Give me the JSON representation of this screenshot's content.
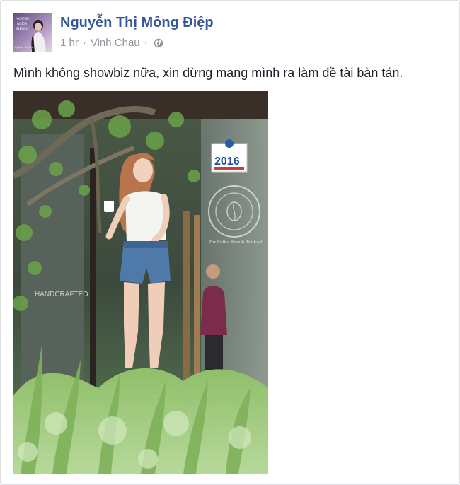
{
  "post": {
    "author": "Nguyễn Thị Mông Điệp",
    "time": "1 hr",
    "separator": "·",
    "location": "Vinh Chau",
    "privacy_icon": "globe-icon",
    "text": "Mình không showbiz nữa, xin đừng mang mình ra làm đề tài bàn tán."
  },
  "avatar": {
    "lettering": [
      "NGƯỢC",
      "MIỀN",
      "BIỂN Ư",
      "Kỳ Hân - Ha Mai Trúc"
    ]
  },
  "photo": {
    "sign_year": "2016",
    "logo_text": "The Coffee Bean & Tea Leaf",
    "window_text": "HANDCRAFTED"
  },
  "colors": {
    "author_link": "#365899",
    "meta_gray": "#90949c",
    "text": "#1d2129",
    "border": "#dddfe2"
  }
}
